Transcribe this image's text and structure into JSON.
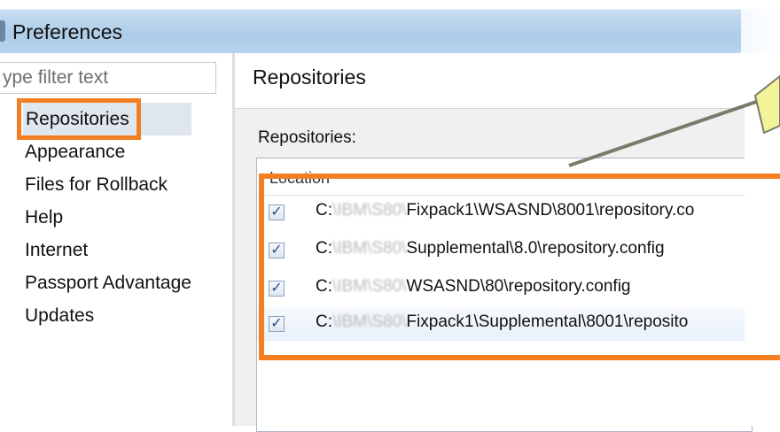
{
  "window": {
    "title": "Preferences"
  },
  "sidebar": {
    "filter_placeholder": "ype filter text",
    "items": [
      {
        "label": "Repositories"
      },
      {
        "label": "Appearance"
      },
      {
        "label": "Files for Rollback"
      },
      {
        "label": "Help"
      },
      {
        "label": "Internet"
      },
      {
        "label": "Passport Advantage"
      },
      {
        "label": "Updates"
      }
    ],
    "selected": "Repositories"
  },
  "page": {
    "title": "Repositories",
    "section_label": "Repositories:",
    "table": {
      "column_header": "Location",
      "rows": [
        {
          "checked": true,
          "drive": "C:",
          "redacted": "\\IBM\\S80\\",
          "path": "Fixpack1\\WSASND\\8001\\repository.co"
        },
        {
          "checked": true,
          "drive": "C:",
          "redacted": "\\IBM\\S80\\",
          "path": "Supplemental\\8.0\\repository.config"
        },
        {
          "checked": true,
          "drive": "C:",
          "redacted": "\\IBM\\S80\\",
          "path": "WSASND\\80\\repository.config"
        },
        {
          "checked": true,
          "drive": "C:",
          "redacted": "\\IBM\\S80\\",
          "path": "Fixpack1\\Supplemental\\8001\\reposito"
        }
      ]
    }
  },
  "annotations": {
    "highlight_color": "#f47f22",
    "arrow_fill": "#f4f39a",
    "arrow_stroke": "#7a7a6a"
  },
  "icons": {
    "checkbox": "check-icon"
  }
}
